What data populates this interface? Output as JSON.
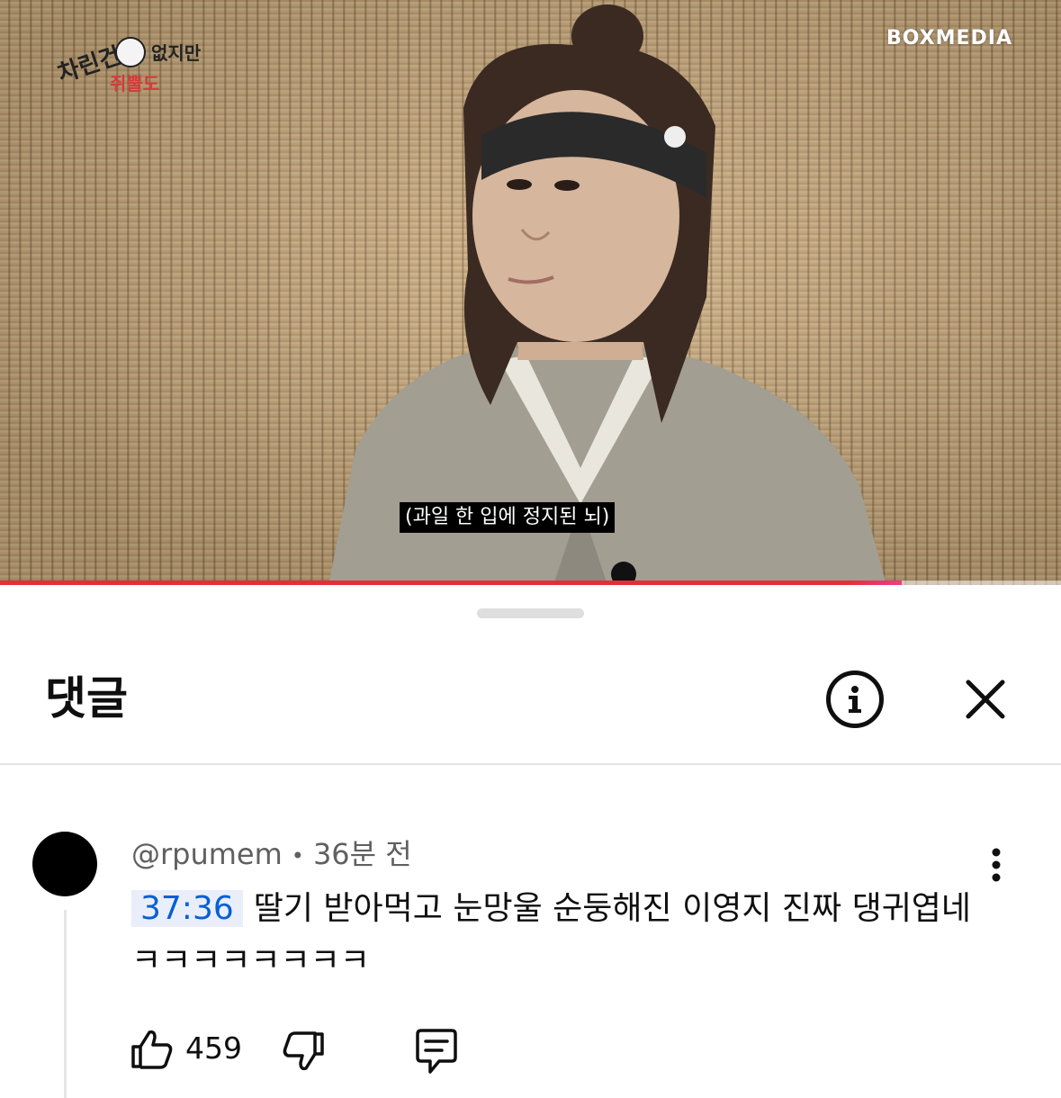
{
  "video": {
    "channel_logo_text": "BOXMEDIA",
    "show_logo_text": "차린건 쥐뿔도 없지만",
    "subtitle": "(과일 한 입에 정지된 뇌)",
    "progress": 0.85,
    "progress_color": "#e52d3a"
  },
  "panel": {
    "title": "댓글",
    "info_icon": "info-circle-icon",
    "close_icon": "close-icon"
  },
  "comment": {
    "author": "@rpumem",
    "separator": "•",
    "time": "36분 전",
    "timestamp": "37:36",
    "text": "딸기 받아먹고 눈망울 순둥해진 이영지 진짜 댕귀엽네 ㅋㅋㅋㅋㅋㅋㅋㅋ",
    "likes": "459",
    "icons": [
      "thumbs-up-icon",
      "thumbs-down-icon",
      "reply-icon",
      "more-vert-icon"
    ]
  }
}
